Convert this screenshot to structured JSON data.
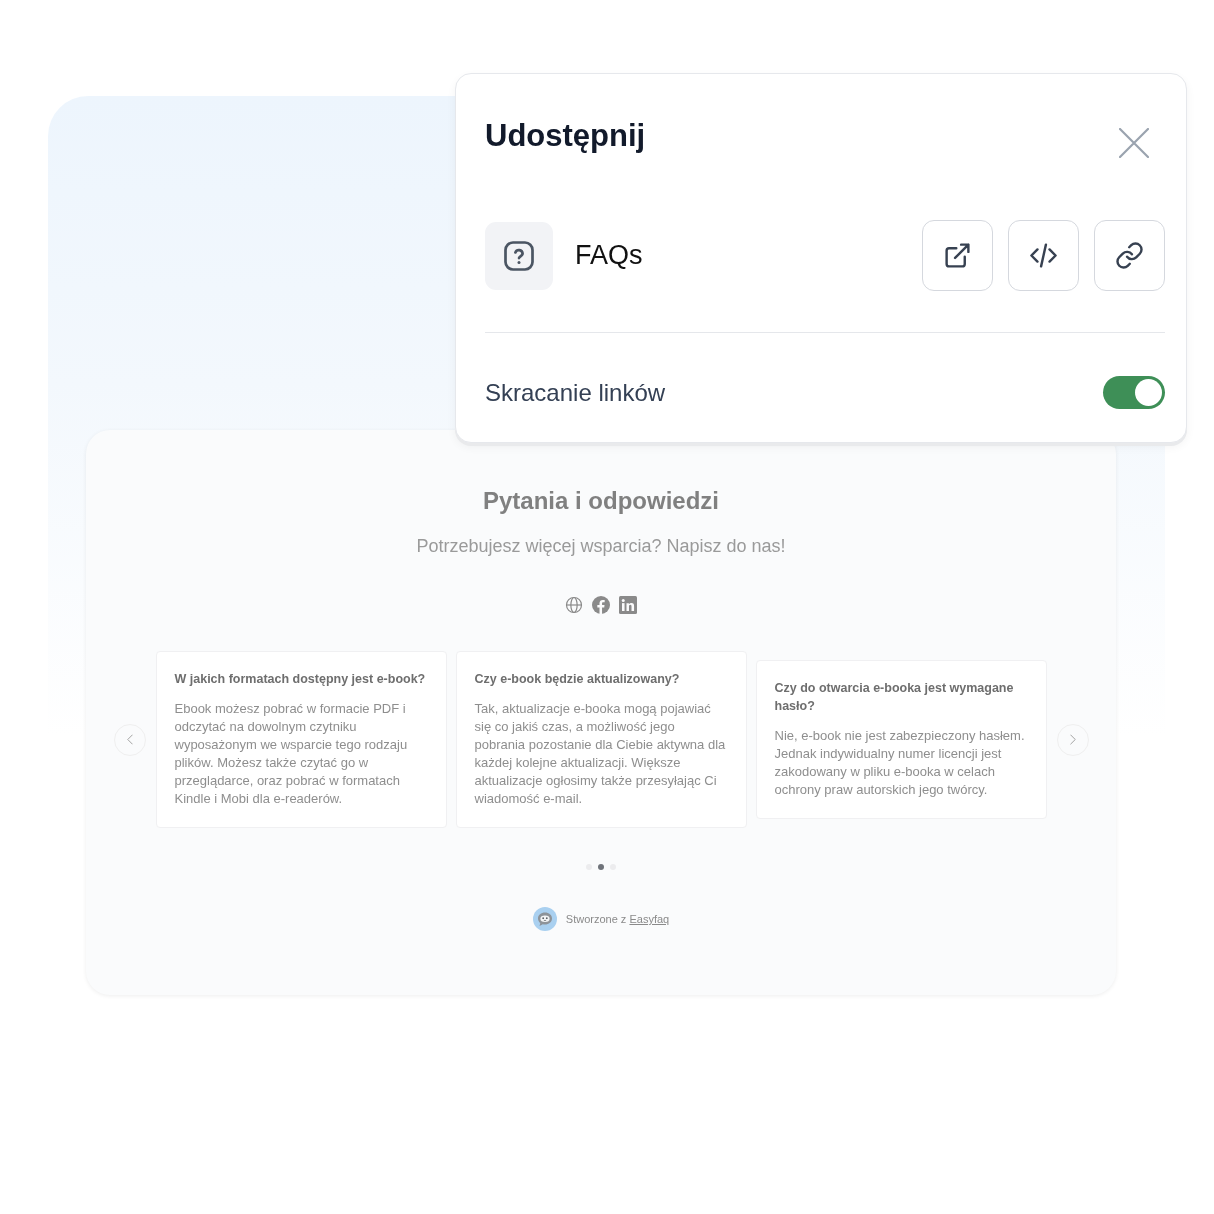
{
  "share_dialog": {
    "title": "Udostępnij",
    "item": {
      "label": "FAQs"
    },
    "link_shortening": {
      "label": "Skracanie linków",
      "on": true
    }
  },
  "faq_widget": {
    "title": "Pytania i odpowiedzi",
    "subtitle": "Potrzebujesz więcej wsparcia? Napisz do nas!",
    "faqs": [
      {
        "question": "W jakich formatach dostępny jest e-book?",
        "answer": "Ebook możesz pobrać w formacie PDF i odczytać na dowolnym czytniku wyposażonym we wsparcie tego rodzaju plików. Możesz także czytać go w przeglądarce, oraz pobrać w formatach Kindle i Mobi dla e-readerów."
      },
      {
        "question": "Czy e-book będzie aktualizowany?",
        "answer": "Tak, aktualizacje e-booka mogą pojawiać się co jakiś czas, a możliwość jego pobrania pozostanie dla Ciebie aktywna dla każdej kolejne aktualizacji. Większe aktualizacje ogłosimy także przesyłając Ci wiadomość e-mail."
      },
      {
        "question": "Czy do otwarcia e-booka jest wymagane hasło?",
        "answer": "Nie, e-book nie jest zabezpieczony hasłem. Jednak indywidualny numer licencji jest zakodowany w pliku e-booka w celach ochrony praw autorskich jego twórcy."
      }
    ],
    "pages": [
      {
        "selected": false
      },
      {
        "selected": true
      },
      {
        "selected": false
      }
    ],
    "footer": {
      "text": "Stworzone z",
      "link": "Easyfaq"
    }
  }
}
